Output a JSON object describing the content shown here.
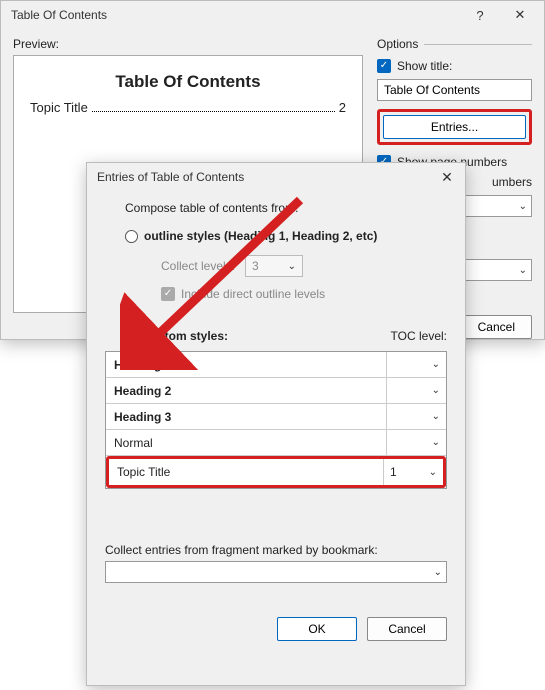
{
  "main": {
    "title": "Table Of Contents",
    "preview_label": "Preview:",
    "preview_title": "Table Of Contents",
    "preview_item_text": "Topic Title",
    "preview_item_page": "2",
    "options_label": "Options",
    "show_title_label": "Show title:",
    "title_field_value": "Table Of Contents",
    "entries_button": "Entries...",
    "show_page_numbers": "Show page numbers",
    "numbers_partial": "umbers",
    "cancel": "Cancel"
  },
  "sub": {
    "title": "Entries of Table of Contents",
    "compose": "Compose table of contents from:",
    "outline_radio": "outline styles (Heading 1, Heading 2, etc)",
    "collect_levels": "Collect levels:",
    "levels_value": "3",
    "include_direct": "Include direct outline levels",
    "custom_radio": "custom styles:",
    "toc_level": "TOC level:",
    "styles": [
      {
        "name": "Heading 1",
        "level": ""
      },
      {
        "name": "Heading 2",
        "level": ""
      },
      {
        "name": "Heading 3",
        "level": ""
      },
      {
        "name": "Normal",
        "level": ""
      },
      {
        "name": "Topic Title",
        "level": "1"
      }
    ],
    "collect_bookmark": "Collect entries from fragment marked by bookmark:",
    "ok": "OK",
    "cancel": "Cancel"
  }
}
